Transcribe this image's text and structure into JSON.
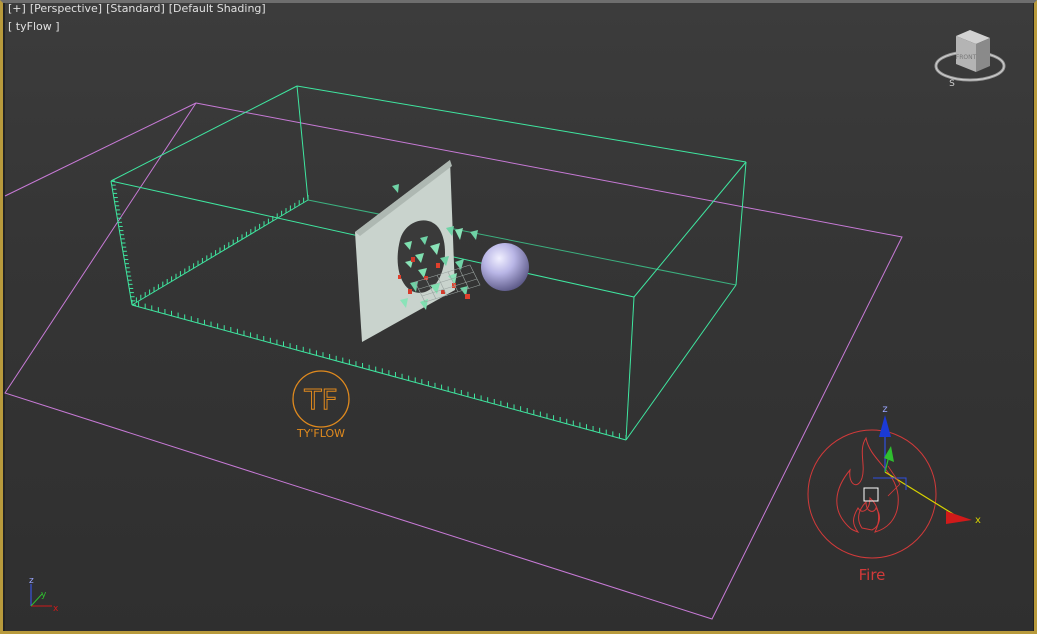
{
  "viewport": {
    "labels": [
      "[+]",
      "[Perspective]",
      "[Standard]",
      "[Default Shading]"
    ],
    "object_label": "[ tyFlow ]"
  },
  "viewcube": {
    "face": "FRONT",
    "compass_south": "S"
  },
  "tyflow_icon": {
    "monogram": "TF",
    "label": "TY'FLOW",
    "color": "#e08a1e"
  },
  "fire_helper": {
    "label": "Fire",
    "color": "#d23a3a"
  },
  "gizmo": {
    "x_label": "x",
    "z_label": "z"
  },
  "axis_tripod": {
    "x": "x",
    "y": "y",
    "z": "z"
  },
  "colors": {
    "bounding_box": "#3fe6a0",
    "grid_plane": "#c77ad6",
    "wall": "#c9d3cd",
    "sphere": "#b9b6e6"
  }
}
